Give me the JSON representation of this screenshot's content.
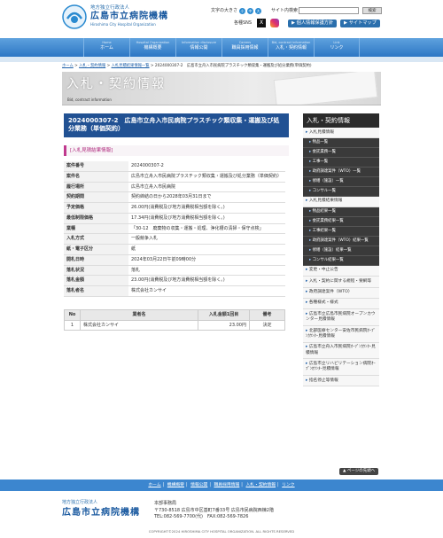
{
  "header": {
    "org_small": "地方独立行政法人",
    "logo_main": "広島市立病院機構",
    "logo_en": "Hiroshima City Hospital Organization",
    "font_size_label": "文字の大きさ",
    "font_btns": [
      "小",
      "中",
      "大"
    ],
    "search_label": "サイト内検索",
    "search_button": "検索",
    "sns_label": "各種SNS",
    "x_icon": "X",
    "privacy_button": "▶ 個人情報保護方針",
    "sitemap_button": "▶ サイトマップ"
  },
  "gnav": [
    {
      "en": "Home",
      "ja": "ホーム"
    },
    {
      "en": "Hospital Organization",
      "ja": "機構概要"
    },
    {
      "en": "Information disclosure",
      "ja": "情報公開"
    },
    {
      "en": "Careers",
      "ja": "職員採用情報"
    },
    {
      "en": "Bid, contract information",
      "ja": "入札・契約情報"
    },
    {
      "en": "Link",
      "ja": "リンク"
    }
  ],
  "breadcrumb": {
    "home": "ホーム",
    "sep": ">",
    "contract": "入札・契約情報",
    "results": "入札見積結果情報一覧",
    "current": "2024000307-2　広島市立舟入市民病院プラスチック類収集・運搬及び処分業務(単価契約)"
  },
  "banner": {
    "ja": "入札・契約情報",
    "en": "Bid, contract information"
  },
  "page_title": "2024000307-2　広島市立舟入市民病院プラスチック類収集・運搬及び処分業務（単価契約）",
  "section_label": "[入札見積結果情報]",
  "details": [
    {
      "k": "案件番号",
      "v": "2024000307-2"
    },
    {
      "k": "案件名",
      "v": "広島市立舟入市民病院プラスチック類収集・運搬及び処分業務（単価契約）"
    },
    {
      "k": "履行場所",
      "v": "広島市立舟入市民病院"
    },
    {
      "k": "契約期間",
      "v": "契約締結の日から2028年03月31日まで"
    },
    {
      "k": "予定価格",
      "v": "26.00円(消費税及び地方消費税相当額を除く。)"
    },
    {
      "k": "最低制限価格",
      "v": "17.34円(消費税及び地方消費税相当額を除く。)"
    },
    {
      "k": "業種",
      "v": "「30-12　廃棄物の収集・運搬・処理、浄化槽の清掃・保守点検」"
    },
    {
      "k": "入札方式",
      "v": "一般競争入札"
    },
    {
      "k": "紙・電子区分",
      "v": "紙"
    },
    {
      "k": "開札日時",
      "v": "2024年03月22日午前09時00分"
    },
    {
      "k": "落札状況",
      "v": "落札"
    },
    {
      "k": "落札金額",
      "v": "23.00円(消費税及び地方消費税相当額を除く。)"
    },
    {
      "k": "落札者名",
      "v": "株式会社カンサイ"
    }
  ],
  "results": {
    "headers": [
      "No",
      "業者名",
      "入札金額1回目",
      "備考"
    ],
    "rows": [
      {
        "no": "1",
        "name": "株式会社カンサイ",
        "amount": "23.00円",
        "note": "決定"
      }
    ]
  },
  "sidebar": {
    "title": "入札・契約情報",
    "groups": [
      {
        "label": "入札見積情報",
        "subs": [
          "物品一覧",
          "委託業務一覧",
          "工事一覧",
          "政府調達案件（WTO）一覧",
          "修繕（施設）一覧",
          "コンサル一覧"
        ]
      },
      {
        "label": "入札見積結果情報",
        "subs": [
          "物品結果一覧",
          "委託業務結果一覧",
          "工事結果一覧",
          "政府調達案件（WTO）結果一覧",
          "修繕（施設）結果一覧",
          "コンサル結果一覧"
        ]
      }
    ],
    "items": [
      "変更・中止公告",
      "入札・契約に関する規程・要綱等",
      "政府調達案件（WTO）",
      "各種様式・様式",
      "広島市立広島市民病院オープンカウンター見積情報",
      "北部医療センター安佐市民病院ｵｰﾌﾟﾝｶｳﾝﾀｰ見積情報",
      "広島市立舟入市民病院ｵｰﾌﾟﾝｶｳﾝﾀｰ見積情報",
      "広島市立リハビリテーション病院ｵｰﾌﾟﾝｶｳﾝﾀｰ見積情報",
      "指名停止等情報"
    ]
  },
  "page_top": "▲ ページの先頭へ",
  "footer_nav": [
    "ホーム",
    "機構概要",
    "情報公開",
    "職員採用情報",
    "入札・契約情報",
    "リンク"
  ],
  "footer": {
    "org_small": "地方独立行政法人",
    "logo_main": "広島市立病院機構",
    "office": "本部事務局",
    "address": "〒730-8518 広島市中区基町7番33号 広島市民病院西棟2階",
    "tel": "TEL:082-569-7700(代)　FAX:082-569-7826",
    "copyright": "COPYRIGHT©2024 HIROSHIMA CITY HOSPITAL ORGANIZATION. ALL RIGHTS RESERVED"
  }
}
